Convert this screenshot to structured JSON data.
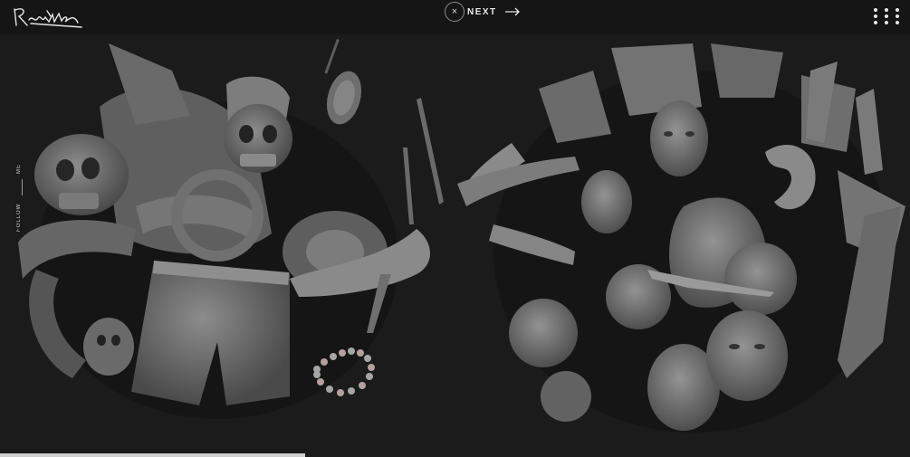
{
  "header": {
    "logo_signature": "Rosmawk",
    "close_symbol": "×",
    "next_label": "NEXT"
  },
  "sidebar": {
    "follow_label": "FOLLOW",
    "me_label": "ME"
  },
  "gallery": {
    "left_artwork": "sculpture-collection-apparel",
    "right_artwork": "sculpture-collection-anatomy"
  },
  "colors": {
    "background": "#1b1b1c",
    "topbar": "#151515",
    "sculpt": "#6f6f6f",
    "accent_text": "#e8e8e8"
  },
  "progress": 0.335
}
